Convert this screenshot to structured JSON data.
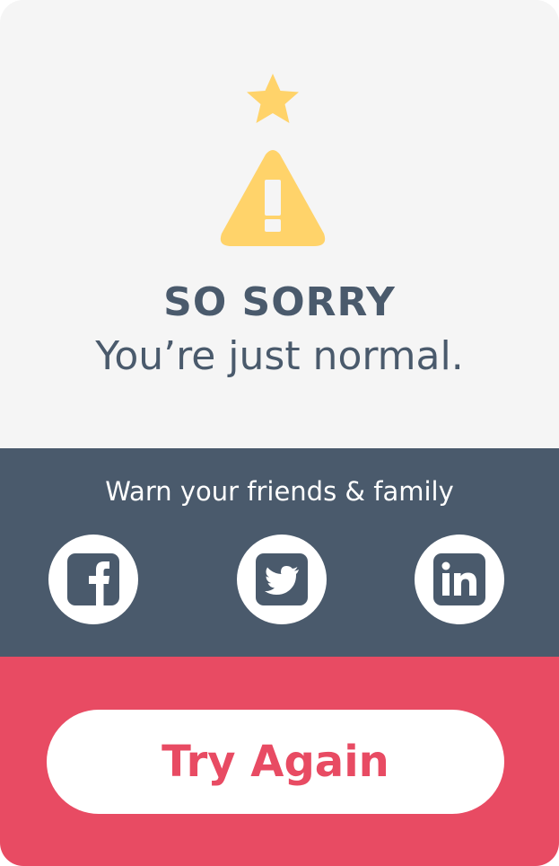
{
  "result": {
    "headline": "SO SORRY",
    "message": "You’re just normal.",
    "icons": [
      "star-icon",
      "warning-icon"
    ],
    "accent_color": "#ffd36a"
  },
  "share": {
    "title": "Warn your friends & family",
    "buttons": [
      {
        "name": "facebook",
        "icon": "facebook-icon"
      },
      {
        "name": "twitter",
        "icon": "twitter-icon"
      },
      {
        "name": "linkedin",
        "icon": "linkedin-icon"
      }
    ],
    "background_color": "#4a5a6c"
  },
  "action": {
    "try_again_label": "Try Again",
    "background_color": "#e84b63"
  }
}
